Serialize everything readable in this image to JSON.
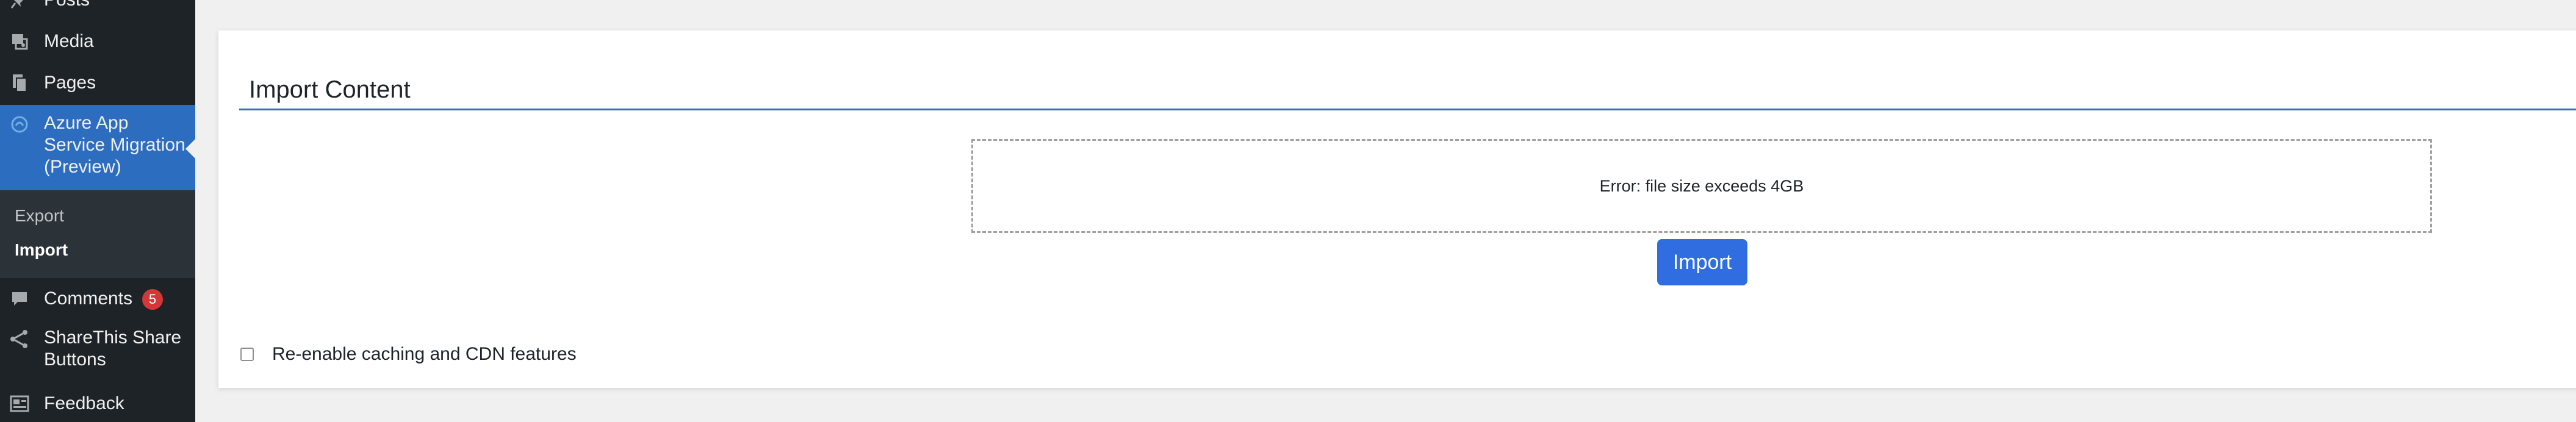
{
  "sidebar": {
    "items": [
      {
        "label": "Posts",
        "icon": "pin-icon"
      },
      {
        "label": "Media",
        "icon": "media-icon"
      },
      {
        "label": "Pages",
        "icon": "pages-icon"
      },
      {
        "label": "Azure App Service Migration (Preview)",
        "icon": "azure-icon"
      },
      {
        "label": "Comments",
        "icon": "comment-icon",
        "badge": "5"
      },
      {
        "label": "ShareThis Share Buttons",
        "icon": "share-icon"
      },
      {
        "label": "Feedback",
        "icon": "feedback-icon"
      }
    ],
    "submenu": [
      {
        "label": "Export"
      },
      {
        "label": "Import"
      }
    ],
    "active_color": "#2c6dbf"
  },
  "main": {
    "title": "Import Content",
    "dropzone_message": "Error: file size exceeds 4GB",
    "import_button": "Import",
    "cache_option_label": "Re-enable caching and CDN features",
    "cache_option_checked": false,
    "accent_color": "#2f6de1"
  }
}
